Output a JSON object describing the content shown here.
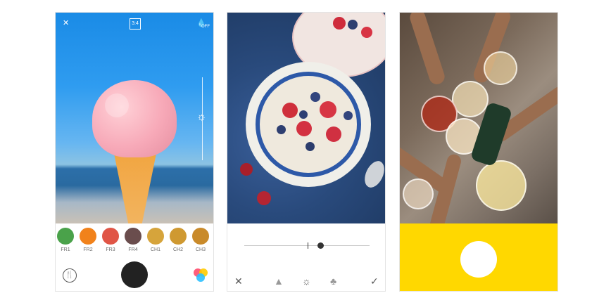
{
  "phone1": {
    "top_icons": [
      "flash-off-icon",
      "aspect-ratio-icon",
      "water-drop-off-icon"
    ],
    "aspect_ratio": "3:4",
    "drop_label": "OFF",
    "filters": [
      {
        "label": "FR1",
        "color": "#4aa24a"
      },
      {
        "label": "FR2",
        "color": "#f1821b"
      },
      {
        "label": "FR3",
        "color": "#e05546"
      },
      {
        "label": "FR4",
        "color": "#6a4d4d"
      },
      {
        "label": "CH1",
        "color": "#d6a43b"
      },
      {
        "label": "CH2",
        "color": "#cf9931"
      },
      {
        "label": "CH3",
        "color": "#c98a2a"
      }
    ],
    "bottom_icons": [
      "fork-knife-icon",
      "shutter-button",
      "color-circles-icon"
    ]
  },
  "phone2": {
    "bottom_icons": [
      "close-icon",
      "adjust-icon",
      "brightness-icon",
      "saturation-icon",
      "check-icon"
    ]
  },
  "phone3": {
    "accent": "#ffd800"
  }
}
